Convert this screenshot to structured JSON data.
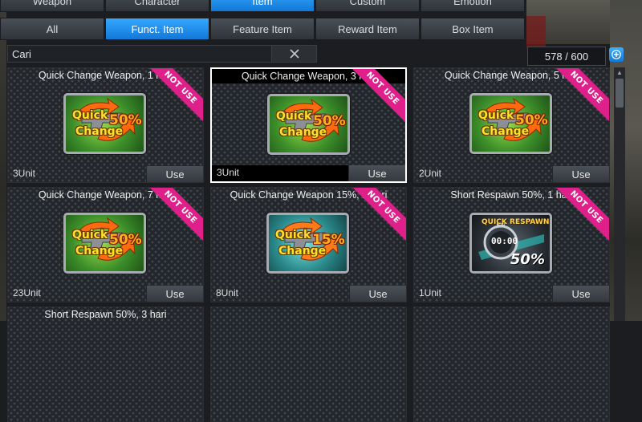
{
  "tabs_primary": [
    {
      "label": "Weapon",
      "active": false
    },
    {
      "label": "Character",
      "active": false
    },
    {
      "label": "Item",
      "active": true
    },
    {
      "label": "Custom",
      "active": false
    },
    {
      "label": "Emotion",
      "active": false
    }
  ],
  "tabs_secondary": [
    {
      "label": "All",
      "active": false
    },
    {
      "label": "Funct. Item",
      "active": true
    },
    {
      "label": "Feature Item",
      "active": false
    },
    {
      "label": "Reward Item",
      "active": false
    },
    {
      "label": "Box Item",
      "active": false
    }
  ],
  "search": {
    "value": "Cari",
    "clear_icon": "close-icon"
  },
  "inventory": {
    "count": "578 / 600",
    "add_icon": "plus-icon"
  },
  "status_badge": "NOT USE",
  "use_label": "Use",
  "items": [
    {
      "title": "Quick Change Weapon, 1 hari",
      "units": "3Unit",
      "icon": "quick-change",
      "icon_line1": "Quick",
      "icon_line2": "Change",
      "percent": "50%",
      "color": "green",
      "selected": false
    },
    {
      "title": "Quick Change Weapon, 3 hari",
      "units": "3Unit",
      "icon": "quick-change",
      "icon_line1": "Quick",
      "icon_line2": "Change",
      "percent": "50%",
      "color": "green",
      "selected": true
    },
    {
      "title": "Quick Change Weapon, 5 hari",
      "units": "2Unit",
      "icon": "quick-change",
      "icon_line1": "Quick",
      "icon_line2": "Change",
      "percent": "50%",
      "color": "green",
      "selected": false
    },
    {
      "title": "Quick Change Weapon, 7 hari",
      "units": "23Unit",
      "icon": "quick-change",
      "icon_line1": "Quick",
      "icon_line2": "Change",
      "percent": "50%",
      "color": "green",
      "selected": false
    },
    {
      "title": "Quick Change Weapon 15%, 1 hari",
      "units": "8Unit",
      "icon": "quick-change",
      "icon_line1": "Quick",
      "icon_line2": "Change",
      "percent": "15%",
      "color": "cyan",
      "selected": false
    },
    {
      "title": "Short Respawn 50%, 1 hari",
      "units": "1Unit",
      "icon": "quick-respawn",
      "icon_line1": "QUICK RESPAWN",
      "icon_line2": "00:00",
      "percent": "50%",
      "color": "dark",
      "selected": false
    },
    {
      "title": "Short Respawn 50%, 3 hari",
      "units": "",
      "icon": "quick-respawn",
      "color": "dark",
      "partial": true
    },
    {
      "title": "",
      "units": "",
      "partial": true,
      "empty": true
    },
    {
      "title": "",
      "units": "",
      "partial": true,
      "empty": true
    }
  ]
}
